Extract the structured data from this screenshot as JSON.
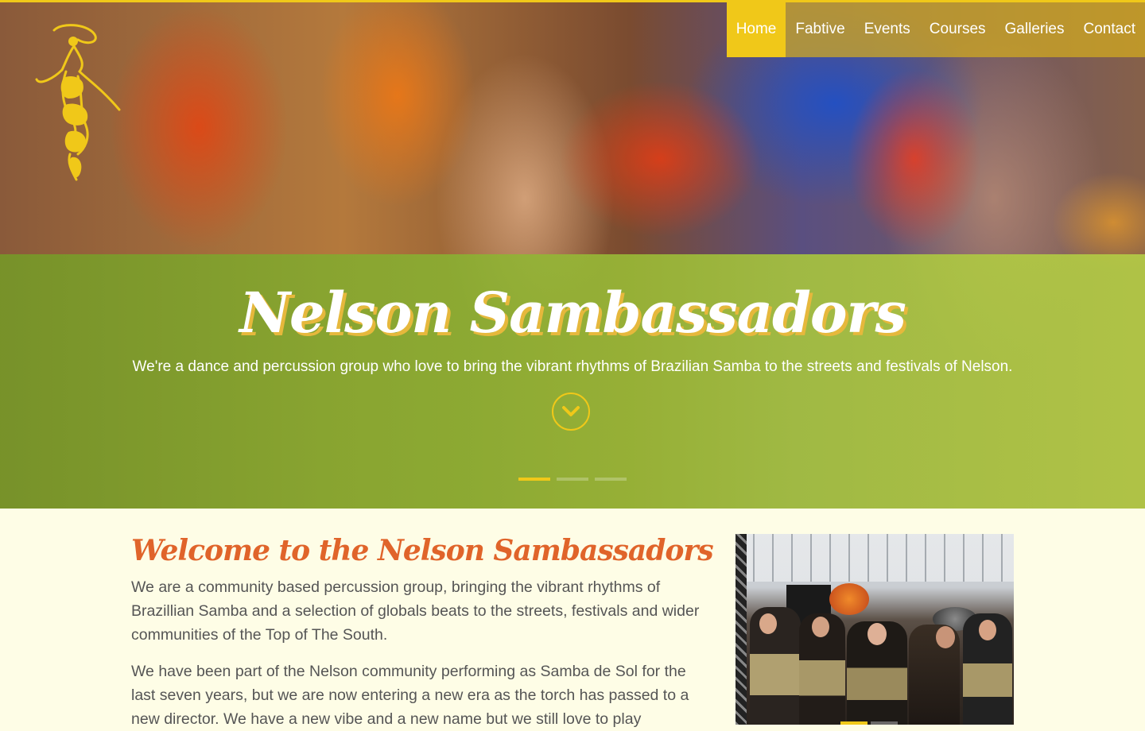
{
  "nav": {
    "items": [
      {
        "label": "Home",
        "active": true
      },
      {
        "label": "Fabtive",
        "active": false
      },
      {
        "label": "Events",
        "active": false
      },
      {
        "label": "Courses",
        "active": false
      },
      {
        "label": "Galleries",
        "active": false
      },
      {
        "label": "Contact",
        "active": false
      }
    ]
  },
  "hero": {
    "title": "Nelson Sambassadors",
    "subtitle": "We're a dance and percussion group who love to bring the vibrant rhythms of Brazilian Samba to the streets and festivals of Nelson.",
    "slides": [
      {
        "active": true
      },
      {
        "active": false
      },
      {
        "active": false
      }
    ]
  },
  "content": {
    "heading": "Welcome to the Nelson Sambassadors",
    "paragraphs": [
      "We are a community based percussion group, bringing the vibrant rhythms of Brazillian Samba and a selection of globals beats to the streets, festivals and wider communities of the Top of The South.",
      "We have been part of the Nelson community performing as Samba de Sol for the last seven years, but we are now entering a new era as the torch has passed to a new director. We have a new vibe and a new name but we still love to play"
    ]
  },
  "icons": {
    "logo": "samba-dancer-logo",
    "scroll": "chevron-down-icon"
  },
  "colors": {
    "accent": "#f0c819",
    "heading": "#e0642a",
    "background": "#fefde6",
    "overlay": "#8ab032"
  }
}
